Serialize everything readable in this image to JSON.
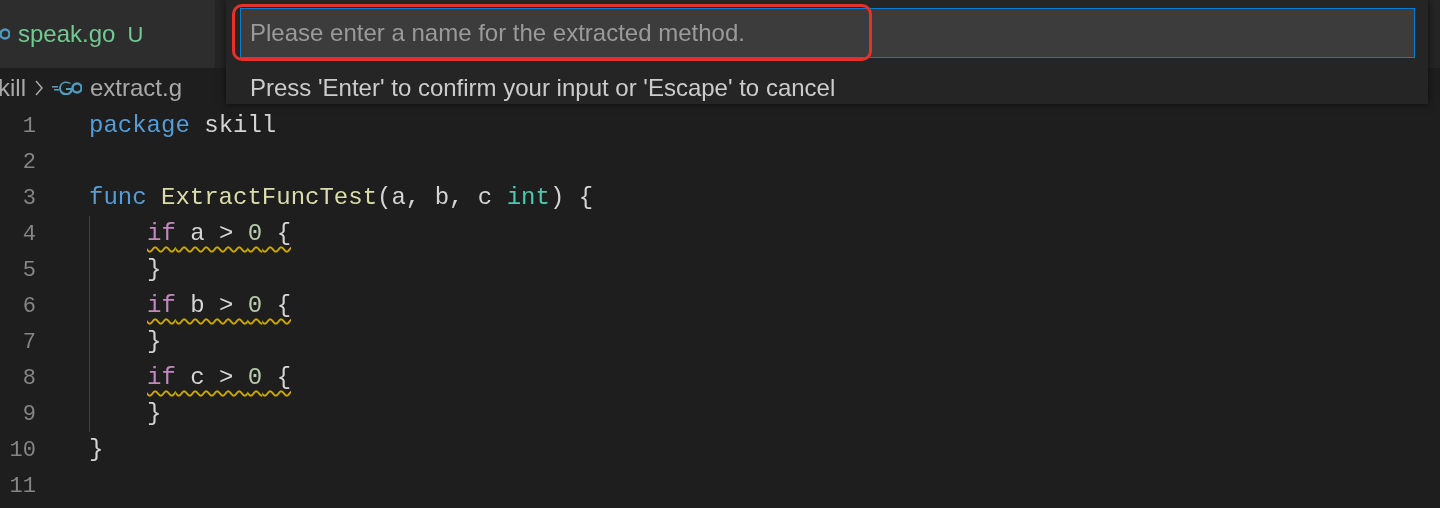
{
  "tab": {
    "name": "speak.go",
    "status": "U"
  },
  "breadcrumb": {
    "folder": "kill",
    "file": "extract.g"
  },
  "quick_input": {
    "placeholder": "Please enter a name for the extracted method.",
    "message": "Press 'Enter' to confirm your input or 'Escape' to cancel",
    "highlighted": true
  },
  "editor": {
    "lines": [
      {
        "number": "1",
        "indented": false,
        "warning": false,
        "tokens": [
          {
            "text": "package",
            "kind": "keyword"
          },
          {
            "text": " skill",
            "kind": "plain"
          }
        ]
      },
      {
        "number": "2",
        "indented": false
      },
      {
        "number": "3",
        "indented": false,
        "warning": false,
        "tokens": [
          {
            "text": "func",
            "kind": "keyword"
          },
          {
            "text": " ExtractFuncTest",
            "kind": "function"
          },
          {
            "text": "(a, b, c ",
            "kind": "plain"
          },
          {
            "text": "int",
            "kind": "type"
          },
          {
            "text": ") {",
            "kind": "plain"
          }
        ]
      },
      {
        "number": "4",
        "indented": true,
        "warning": true,
        "tokens": [
          {
            "text": "if",
            "kind": "control"
          },
          {
            "text": " a > ",
            "kind": "plain"
          },
          {
            "text": "0",
            "kind": "number"
          },
          {
            "text": " {",
            "kind": "plain"
          }
        ]
      },
      {
        "number": "5",
        "indented": true,
        "warning": false,
        "tokens": [
          {
            "text": "}",
            "kind": "plain"
          }
        ]
      },
      {
        "number": "6",
        "indented": true,
        "warning": true,
        "tokens": [
          {
            "text": "if",
            "kind": "control"
          },
          {
            "text": " b > ",
            "kind": "plain"
          },
          {
            "text": "0",
            "kind": "number"
          },
          {
            "text": " {",
            "kind": "plain"
          }
        ]
      },
      {
        "number": "7",
        "indented": true,
        "warning": false,
        "tokens": [
          {
            "text": "}",
            "kind": "plain"
          }
        ]
      },
      {
        "number": "8",
        "indented": true,
        "warning": true,
        "tokens": [
          {
            "text": "if",
            "kind": "control"
          },
          {
            "text": " c > ",
            "kind": "plain"
          },
          {
            "text": "0",
            "kind": "number"
          },
          {
            "text": " {",
            "kind": "plain"
          }
        ]
      },
      {
        "number": "9",
        "indented": true,
        "warning": false,
        "tokens": [
          {
            "text": "}",
            "kind": "plain"
          }
        ]
      },
      {
        "number": "10",
        "indented": false,
        "warning": false,
        "tokens": [
          {
            "text": "}",
            "kind": "plain"
          }
        ]
      },
      {
        "number": "11",
        "indented": false
      }
    ]
  }
}
